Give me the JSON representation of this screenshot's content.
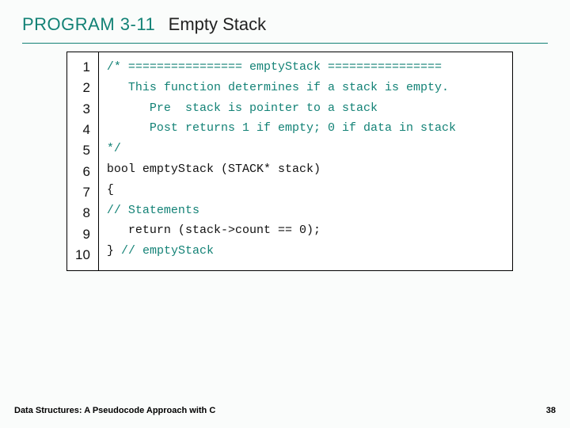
{
  "header": {
    "program_label": "PROGRAM 3-11",
    "program_title": "Empty Stack"
  },
  "code": {
    "line_numbers": [
      "1",
      "2",
      "3",
      "4",
      "5",
      "6",
      "7",
      "8",
      "9",
      "10"
    ],
    "lines": [
      {
        "cls": "teal",
        "text": "/* ================ emptyStack ================"
      },
      {
        "cls": "teal",
        "text": "   This function determines if a stack is empty."
      },
      {
        "cls": "teal",
        "text": "      Pre  stack is pointer to a stack"
      },
      {
        "cls": "teal",
        "text": "      Post returns 1 if empty; 0 if data in stack"
      },
      {
        "cls": "teal",
        "text": "*/"
      },
      {
        "cls": "blk",
        "text": "bool emptyStack (STACK* stack)"
      },
      {
        "cls": "blk",
        "text": "{"
      },
      {
        "cls": "teal",
        "text": "// Statements"
      },
      {
        "cls": "blk",
        "text": "   return (stack->count == 0);"
      },
      {
        "cls": "mix",
        "text_blk": "} ",
        "text_teal": "// emptyStack"
      }
    ]
  },
  "footer": {
    "book_title": "Data Structures: A Pseudocode Approach with C",
    "page_number": "38"
  }
}
